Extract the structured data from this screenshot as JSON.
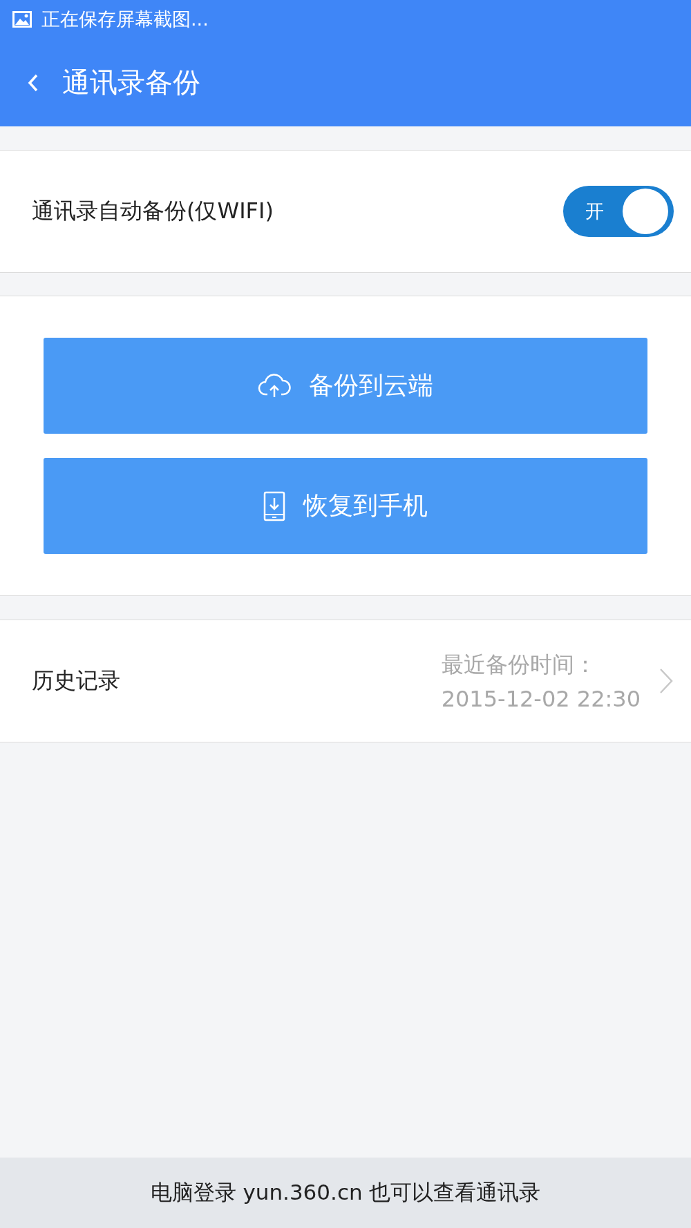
{
  "status_bar": {
    "text": "正在保存屏幕截图..."
  },
  "header": {
    "title": "通讯录备份"
  },
  "auto_backup": {
    "label": "通讯录自动备份(仅WIFI)",
    "toggle": {
      "on": true,
      "label": "开"
    }
  },
  "actions": [
    {
      "kind": "upload",
      "label": "备份到云端"
    },
    {
      "kind": "download",
      "label": "恢复到手机"
    }
  ],
  "history": {
    "label": "历史记录",
    "caption": "最近备份时间：",
    "time": "2015-12-02 22:30"
  },
  "footer": "电脑登录 yun.360.cn 也可以查看通讯录"
}
